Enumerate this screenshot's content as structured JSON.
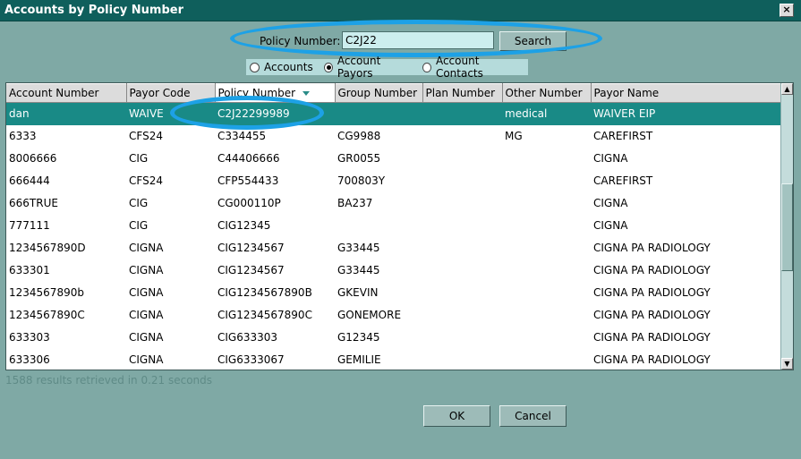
{
  "window": {
    "title": "Accounts by Policy Number",
    "close_glyph": "×"
  },
  "search": {
    "label": "Policy Number:",
    "value": "C2J22",
    "button": "Search"
  },
  "filter": {
    "options": [
      {
        "label": "Accounts",
        "checked": false
      },
      {
        "label": "Account Payors",
        "checked": true
      },
      {
        "label": "Account Contacts",
        "checked": false
      }
    ]
  },
  "grid": {
    "sorted_column": "Policy Number",
    "columns": [
      "Account Number",
      "Payor Code",
      "Policy Number",
      "Group Number",
      "Plan Number",
      "Other Number",
      "Payor Name"
    ],
    "rows": [
      {
        "cells": [
          "dan",
          "WAIVE",
          "C2J22299989",
          "",
          "",
          "medical",
          "WAIVER EIP"
        ],
        "selected": true
      },
      {
        "cells": [
          "6333",
          "CFS24",
          "C334455",
          "CG9988",
          "",
          "MG",
          "CAREFIRST"
        ]
      },
      {
        "cells": [
          "8006666",
          "CIG",
          "C44406666",
          "GR0055",
          "",
          "",
          "CIGNA"
        ]
      },
      {
        "cells": [
          "666444",
          "CFS24",
          "CFP554433",
          "700803Y",
          "",
          "",
          "CAREFIRST"
        ]
      },
      {
        "cells": [
          "666TRUE",
          "CIG",
          "CG000110P",
          "BA237",
          "",
          "",
          "CIGNA"
        ]
      },
      {
        "cells": [
          "777111",
          "CIG",
          "CIG12345",
          "",
          "",
          "",
          "CIGNA"
        ]
      },
      {
        "cells": [
          "1234567890D",
          "CIGNA",
          "CIG1234567",
          "G33445",
          "",
          "",
          "CIGNA PA RADIOLOGY"
        ]
      },
      {
        "cells": [
          "633301",
          "CIGNA",
          "CIG1234567",
          "G33445",
          "",
          "",
          "CIGNA PA RADIOLOGY"
        ]
      },
      {
        "cells": [
          "1234567890b",
          "CIGNA",
          "CIG1234567890B",
          "GKEVIN",
          "",
          "",
          "CIGNA PA RADIOLOGY"
        ]
      },
      {
        "cells": [
          "1234567890C",
          "CIGNA",
          "CIG1234567890C",
          "GONEMORE",
          "",
          "",
          "CIGNA PA RADIOLOGY"
        ]
      },
      {
        "cells": [
          "633303",
          "CIGNA",
          "CIG633303",
          "G12345",
          "",
          "",
          "CIGNA PA RADIOLOGY"
        ]
      },
      {
        "cells": [
          "633306",
          "CIGNA",
          "CIG6333067",
          "GEMILIE",
          "",
          "",
          "CIGNA PA RADIOLOGY"
        ]
      }
    ]
  },
  "scrollbar": {
    "up_glyph": "▲",
    "down_glyph": "▼"
  },
  "status": "1588 results retrieved in 0.21 seconds",
  "buttons": {
    "ok": "OK",
    "cancel": "Cancel"
  },
  "colors": {
    "titlebar": "#0f5f5c",
    "selected_row": "#198a86",
    "highlight_ellipse": "#1da1e6",
    "background": "#7fa9a5"
  }
}
